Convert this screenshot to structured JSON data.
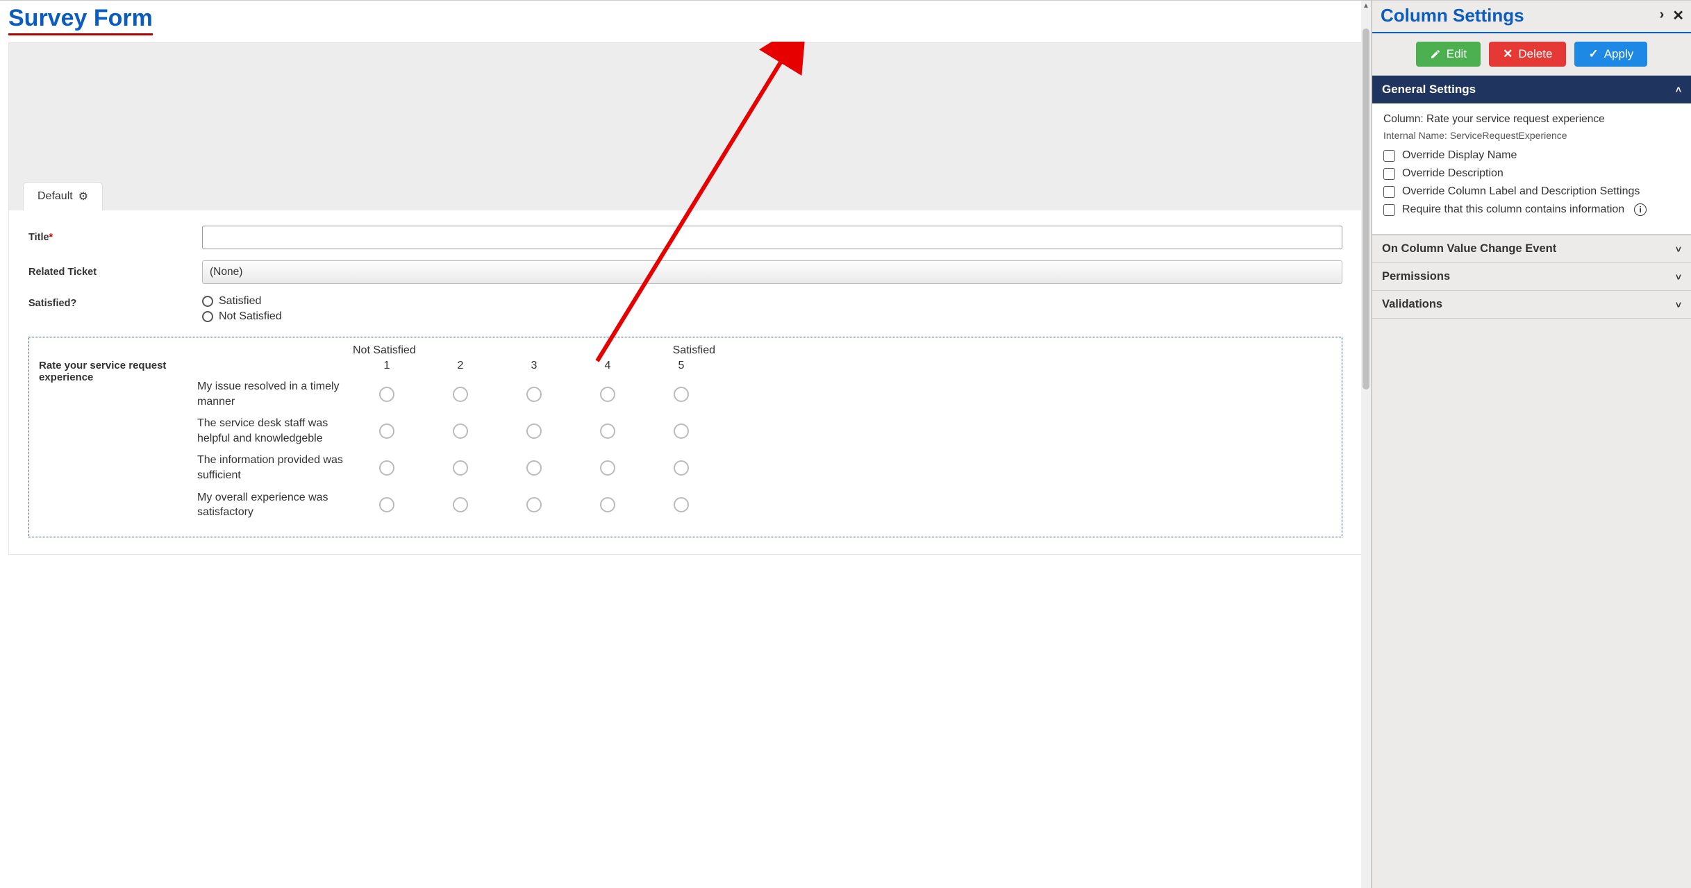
{
  "page": {
    "title": "Survey Form"
  },
  "tab": {
    "default_label": "Default"
  },
  "form": {
    "title_label": "Title",
    "related_ticket_label": "Related Ticket",
    "related_ticket_value": "(None)",
    "satisfied_label": "Satisfied?",
    "satisfied_options": {
      "opt1": "Satisfied",
      "opt2": "Not Satisfied"
    }
  },
  "likert": {
    "field_label": "Rate your service request experience",
    "scale_left": "Not Satisfied",
    "scale_right": "Satisfied",
    "nums": {
      "n1": "1",
      "n2": "2",
      "n3": "3",
      "n4": "4",
      "n5": "5"
    },
    "rows": {
      "r1": "My issue resolved in a timely manner",
      "r2": "The service desk staff was helpful and knowledgeble",
      "r3": "The information provided was sufficient",
      "r4": "My overall experience was satisfactory"
    }
  },
  "side": {
    "title": "Column Settings",
    "buttons": {
      "edit": "Edit",
      "delete": "Delete",
      "apply": "Apply"
    }
  },
  "general": {
    "header": "General Settings",
    "column_label": "Column:",
    "column_value": "Rate your service request experience",
    "internal_label": "Internal Name:",
    "internal_value": "ServiceRequestExperience",
    "chk_override_name": "Override Display Name",
    "chk_override_desc": "Override Description",
    "chk_override_label": "Override Column Label and Description Settings",
    "chk_require": "Require that this column contains information"
  },
  "sections": {
    "on_change": "On Column Value Change Event",
    "permissions": "Permissions",
    "validations": "Validations"
  }
}
